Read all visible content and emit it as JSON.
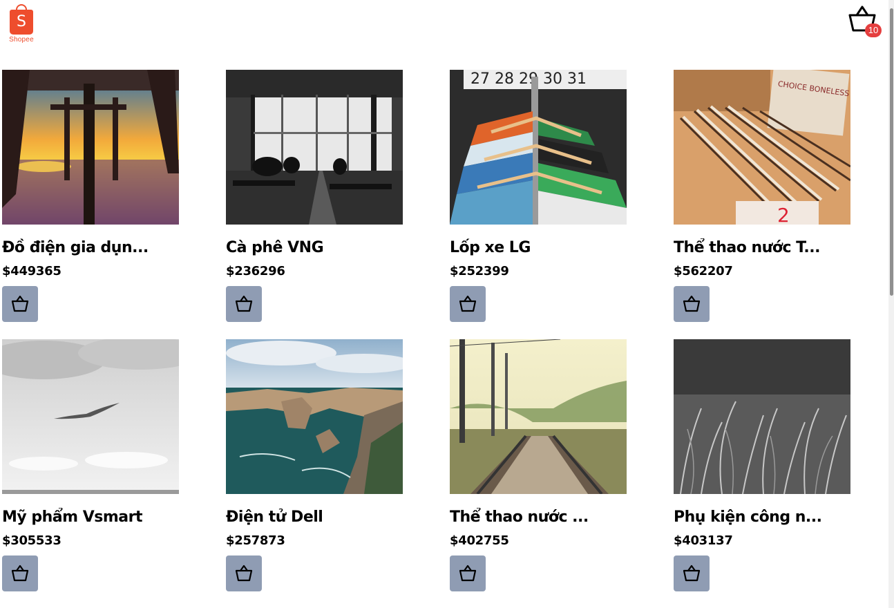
{
  "brand": {
    "logo_letter": "S",
    "name": "Shopee",
    "color": "#ee4d2d"
  },
  "cart": {
    "count": "10",
    "icon": "basket-icon"
  },
  "colors": {
    "add_button_bg": "#8f9cb3",
    "badge_bg": "#e53e3e"
  },
  "products": [
    {
      "name": "Đồ điện gia dụn...",
      "price": "$449365",
      "image": "pier-sunset"
    },
    {
      "name": "Cà phê VNG",
      "price": "$236296",
      "image": "cafe-interior-bw"
    },
    {
      "name": "Lốp xe LG",
      "price": "$252399",
      "image": "clothes-rack"
    },
    {
      "name": "Thể thao nước T...",
      "price": "$562207",
      "image": "measuring-tapes"
    },
    {
      "name": "Mỹ phẩm Vsmart",
      "price": "$305533",
      "image": "seagull-sky-bw"
    },
    {
      "name": "Điện tử Dell",
      "price": "$257873",
      "image": "sea-cliffs"
    },
    {
      "name": "Thể thao nước ...",
      "price": "$402755",
      "image": "railway-tracks"
    },
    {
      "name": "Phụ kiện công n...",
      "price": "$403137",
      "image": "grass-closeup-bw"
    }
  ]
}
